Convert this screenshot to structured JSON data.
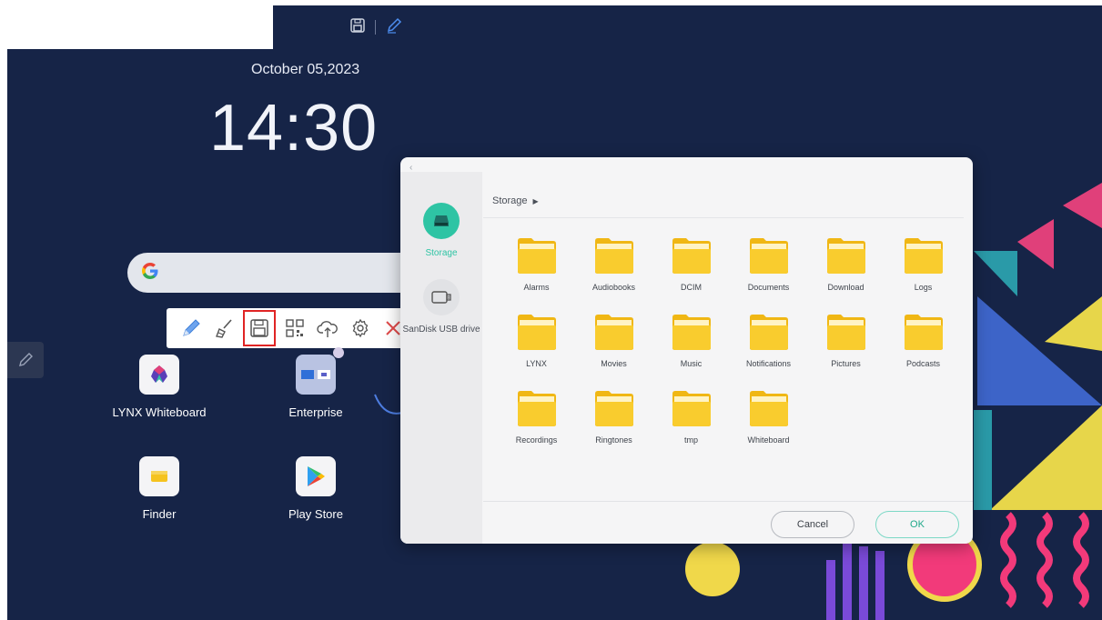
{
  "colors": {
    "background": "#162447",
    "accent": "#2ec4a4",
    "highlight": "#e02424",
    "folder": "#f5c31f"
  },
  "top_bar": {
    "icons": [
      "save-icon",
      "pen-icon"
    ]
  },
  "home": {
    "date": "October 05,2023",
    "time": "14:30"
  },
  "toolbar": {
    "icons": [
      "pen-icon",
      "eraser-icon",
      "save-icon",
      "qr-code-icon",
      "cloud-upload-icon",
      "settings-icon",
      "close-icon"
    ],
    "selected": "save-icon"
  },
  "apps": [
    {
      "label": "LYNX Whiteboard",
      "icon": "lynx-icon"
    },
    {
      "label": "Enterprise",
      "icon": "enterprise-icon"
    },
    {
      "label": "Finder",
      "icon": "finder-icon"
    },
    {
      "label": "Play Store",
      "icon": "play-store-icon"
    }
  ],
  "dialog": {
    "sidebar": [
      {
        "label": "Storage",
        "icon": "storage-icon"
      },
      {
        "label": "SanDisk USB drive",
        "icon": "usb-drive-icon"
      }
    ],
    "breadcrumb": "Storage",
    "folders": [
      "Alarms",
      "Audiobooks",
      "DCIM",
      "Documents",
      "Download",
      "Logs",
      "LYNX",
      "Movies",
      "Music",
      "Notifications",
      "Pictures",
      "Podcasts",
      "Recordings",
      "Ringtones",
      "tmp",
      "Whiteboard"
    ],
    "cancel_label": "Cancel",
    "ok_label": "OK"
  }
}
